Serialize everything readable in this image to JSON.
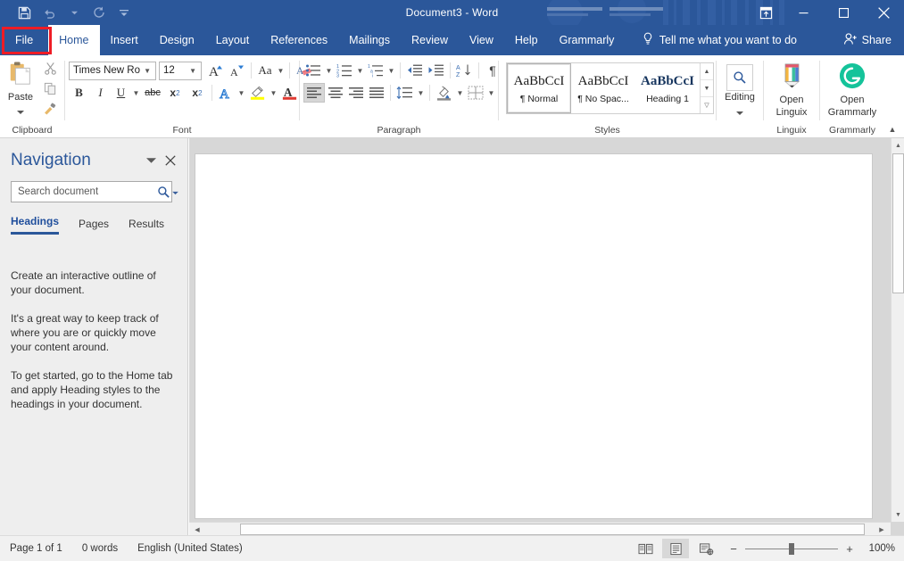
{
  "titlebar": {
    "document_title": "Document3  -  Word",
    "quick_access": [
      {
        "name": "save-icon",
        "label": "Save"
      },
      {
        "name": "undo-icon",
        "label": "Undo"
      },
      {
        "name": "redo-icon",
        "label": "Redo"
      },
      {
        "name": "customize-qat-icon",
        "label": "Customize Quick Access Toolbar"
      }
    ],
    "ribbon_display_options": "Ribbon Display Options",
    "minimize": "Minimize",
    "maximize": "Maximize",
    "close": "Close",
    "accent_color": "#2b579a"
  },
  "ribbon_tabs": [
    {
      "label": "File",
      "active": false,
      "highlighted": true
    },
    {
      "label": "Home",
      "active": true,
      "highlighted": false
    },
    {
      "label": "Insert",
      "active": false,
      "highlighted": false
    },
    {
      "label": "Design",
      "active": false,
      "highlighted": false
    },
    {
      "label": "Layout",
      "active": false,
      "highlighted": false
    },
    {
      "label": "References",
      "active": false,
      "highlighted": false
    },
    {
      "label": "Mailings",
      "active": false,
      "highlighted": false
    },
    {
      "label": "Review",
      "active": false,
      "highlighted": false
    },
    {
      "label": "View",
      "active": false,
      "highlighted": false
    },
    {
      "label": "Help",
      "active": false,
      "highlighted": false
    },
    {
      "label": "Grammarly",
      "active": false,
      "highlighted": false
    }
  ],
  "tell_me": "Tell me what you want to do",
  "share": "Share",
  "highlight_color": "#ee1c25",
  "ribbon": {
    "clipboard": {
      "label": "Clipboard",
      "paste_label": "Paste",
      "cut": "Cut",
      "copy": "Copy",
      "format_painter": "Format Painter",
      "dialog_launcher": "Clipboard settings"
    },
    "font": {
      "label": "Font",
      "font_name": "Times New Ro",
      "font_size": "12",
      "grow_font": "Grow Font",
      "shrink_font": "Shrink Font",
      "change_case": "Aa",
      "clear_formatting": "Clear All Formatting",
      "bold": "B",
      "italic": "I",
      "underline": "U",
      "strikethrough": "abc",
      "subscript": "x",
      "superscript": "x",
      "text_effects": "A",
      "highlight_color": "#ffff00",
      "font_color": "#e03a32",
      "dialog_launcher": "Font settings"
    },
    "paragraph": {
      "label": "Paragraph",
      "bullets": "Bullets",
      "numbering": "Numbering",
      "multilevel": "Multilevel List",
      "decrease_indent": "Decrease Indent",
      "increase_indent": "Increase Indent",
      "sort": "Sort",
      "show_marks": "¶",
      "align_left": "Align Left",
      "align_center": "Center",
      "align_right": "Align Right",
      "justify": "Justify",
      "line_spacing": "Line and Paragraph Spacing",
      "shading": "Shading",
      "borders": "Borders",
      "dialog_launcher": "Paragraph settings"
    },
    "styles": {
      "label": "Styles",
      "items": [
        {
          "preview": "AaBbCcI",
          "name": "¶ Normal",
          "selected": true,
          "heading": false
        },
        {
          "preview": "AaBbCcI",
          "name": "¶ No Spac...",
          "selected": false,
          "heading": false
        },
        {
          "preview": "AaBbCcI",
          "name": "Heading 1",
          "selected": false,
          "heading": true
        }
      ],
      "dialog_launcher": "Styles settings"
    },
    "editing": {
      "label": "Editing",
      "button_label": "Editing"
    },
    "linguix": {
      "label": "Linguix",
      "button_label_1": "Open",
      "button_label_2": "Linguix"
    },
    "grammarly": {
      "label": "Grammarly",
      "button_label_1": "Open",
      "button_label_2": "Grammarly",
      "brand_color": "#15c39a"
    },
    "collapse": "Collapse the Ribbon"
  },
  "navigation": {
    "title": "Navigation",
    "menu": "Task Pane Options",
    "close": "Close",
    "search_placeholder": "Search document",
    "search_value": "",
    "tabs": [
      {
        "label": "Headings",
        "active": true
      },
      {
        "label": "Pages",
        "active": false
      },
      {
        "label": "Results",
        "active": false
      }
    ],
    "body": [
      "Create an interactive outline of your document.",
      "It's a great way to keep track of where you are or quickly move your content around.",
      "To get started, go to the Home tab and apply Heading styles to the headings in your document."
    ]
  },
  "document": {
    "content": ""
  },
  "statusbar": {
    "page": "Page 1 of 1",
    "words": "0 words",
    "language": "English (United States)",
    "views": [
      {
        "name": "read-mode-icon",
        "label": "Read Mode",
        "active": false
      },
      {
        "name": "print-layout-icon",
        "label": "Print Layout",
        "active": true
      },
      {
        "name": "web-layout-icon",
        "label": "Web Layout",
        "active": false
      }
    ],
    "zoom_out": "−",
    "zoom_in": "+",
    "zoom_level": "100%"
  }
}
